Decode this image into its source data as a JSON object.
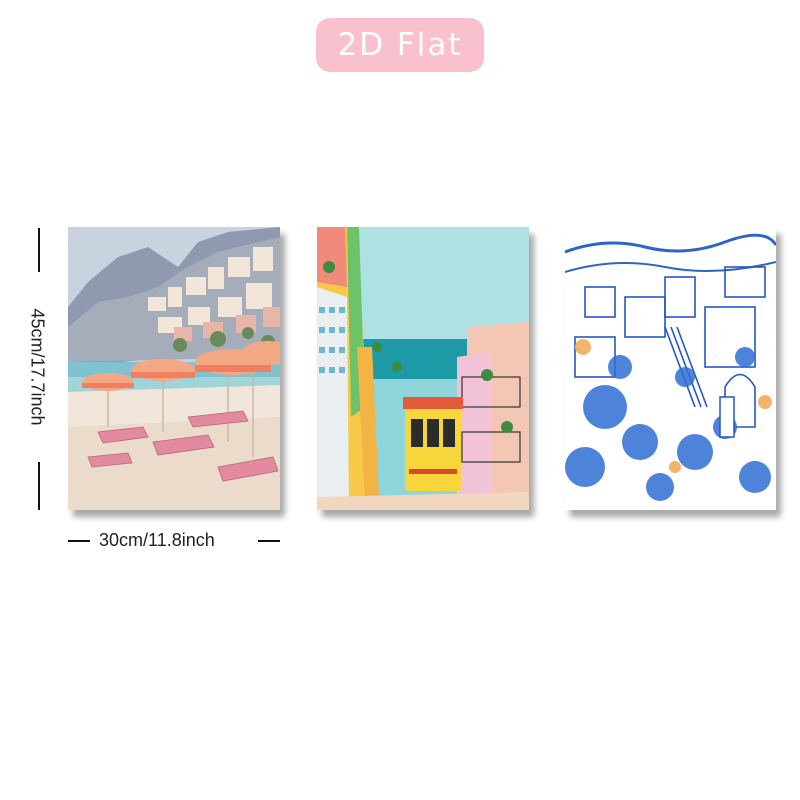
{
  "header": {
    "badge": "2D Flat"
  },
  "dimensions": {
    "height": "45cm/17.7inch",
    "width": "30cm/11.8inch"
  },
  "colors": {
    "badge_bg": "#f9c1cd",
    "badge_text": "#ffffff"
  },
  "artworks": [
    {
      "subject": "beach with pink umbrellas and lounge chairs below a cliffside town"
    },
    {
      "subject": "yellow tram on a colorful tiled street leading to the sea"
    },
    {
      "subject": "blue and white ink sketch of a hillside town"
    }
  ]
}
